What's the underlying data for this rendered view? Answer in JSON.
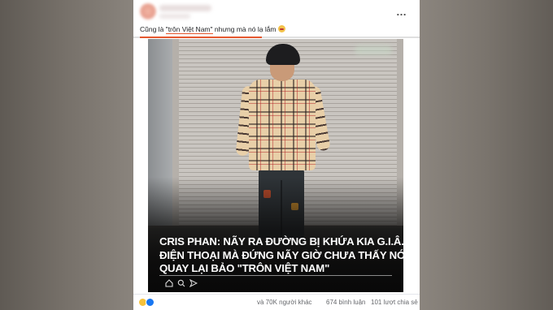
{
  "post": {
    "more_icon": "…",
    "caption_before": "Cũng là ",
    "caption_quoted": "\"trôn Việt Nam\"",
    "caption_after": " nhưng mà nó lạ lắm",
    "caption_emoji": "grimace-emoji"
  },
  "image": {
    "headline_lines": [
      "CRIS PHAN: NÃY RA ĐƯỜNG BỊ KHỨA KIA G.I.Â.T",
      "ĐIỆN THOẠI MÀ ĐỨNG NÃY GIỜ CHƯA THẤY NÓ",
      "QUAY LẠI BẢO \"TRÔN VIỆT NAM\""
    ],
    "icons": [
      "home-icon",
      "search-icon",
      "send-icon"
    ]
  },
  "footer": {
    "reactions": [
      "haha-reaction-icon",
      "like-reaction-icon"
    ],
    "reactions_count": "và 70K người khác",
    "comments": "674 bình luận",
    "shares": "101 lượt chia sẻ"
  },
  "colors": {
    "accent_underline": "#e4572e",
    "like_blue": "#1877f2",
    "haha_yellow": "#f7c23b"
  }
}
